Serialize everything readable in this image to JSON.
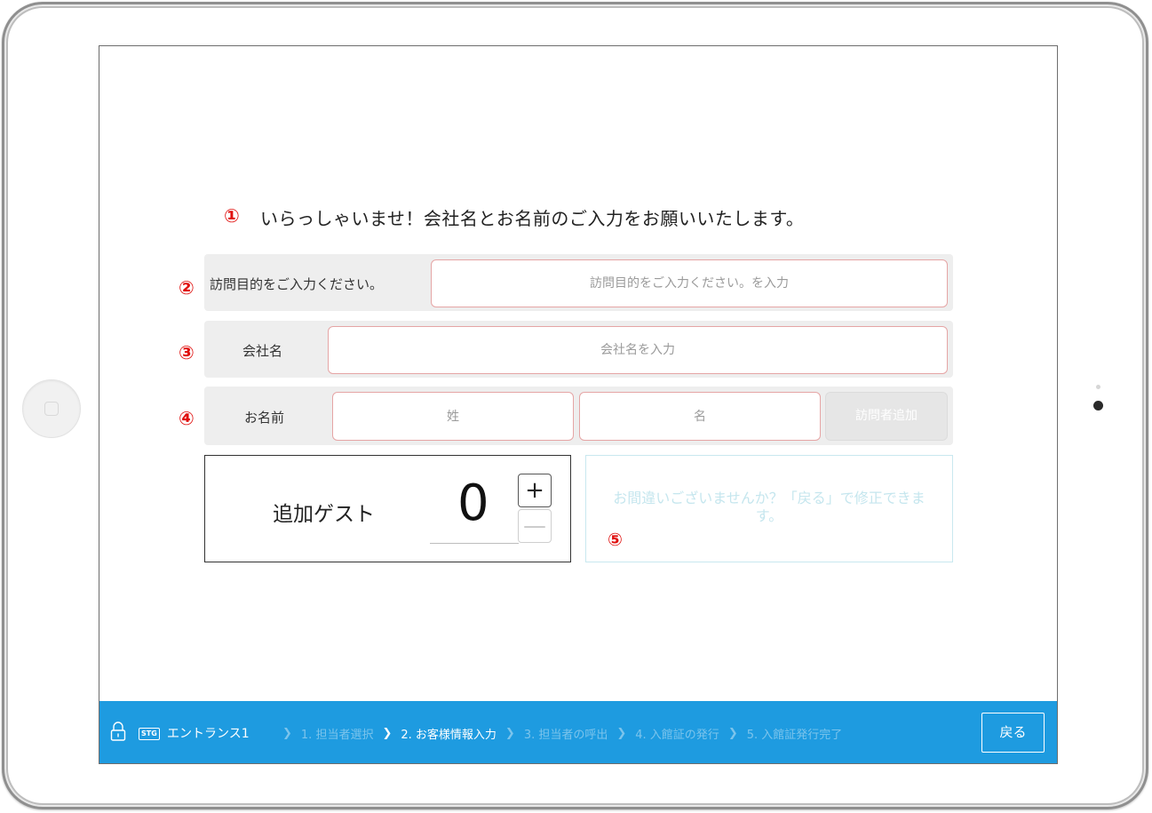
{
  "greeting": {
    "marker": "①",
    "text": "いらっしゃいませ！会社名とお名前のご入力をお願いいたします。"
  },
  "form": {
    "purpose": {
      "marker": "②",
      "label": "訪問目的をご入力ください。",
      "placeholder": "訪問目的をご入力ください。を入力"
    },
    "company": {
      "marker": "③",
      "label": "会社名",
      "placeholder": "会社名を入力"
    },
    "name": {
      "marker": "④",
      "label": "お名前",
      "last_placeholder": "姓",
      "first_placeholder": "名",
      "add_visitor_label": "訪問者追加"
    }
  },
  "guests": {
    "label": "追加ゲスト",
    "count": "0",
    "plus": "+",
    "minus": "—"
  },
  "confirm": {
    "marker": "⑤",
    "text": "お間違いございませんか？「戻る」で修正できます。"
  },
  "bottom_bar": {
    "stg_badge": "STG",
    "entrance": "エントランス1",
    "steps": [
      {
        "label": "1. 担当者選択",
        "active": false
      },
      {
        "label": "2. お客様情報入力",
        "active": true
      },
      {
        "label": "3. 担当者の呼出",
        "active": false
      },
      {
        "label": "4. 入館証の発行",
        "active": false
      },
      {
        "label": "5. 入館証発行完了",
        "active": false
      }
    ],
    "separator": "❯",
    "back_label": "戻る"
  },
  "colors": {
    "accent_blue": "#1e9be0",
    "annotation_red": "#e0100e",
    "field_border": "#e5a5a5"
  },
  "icons": {
    "lock": "lock-icon",
    "chevron": "chevron-right-icon"
  }
}
